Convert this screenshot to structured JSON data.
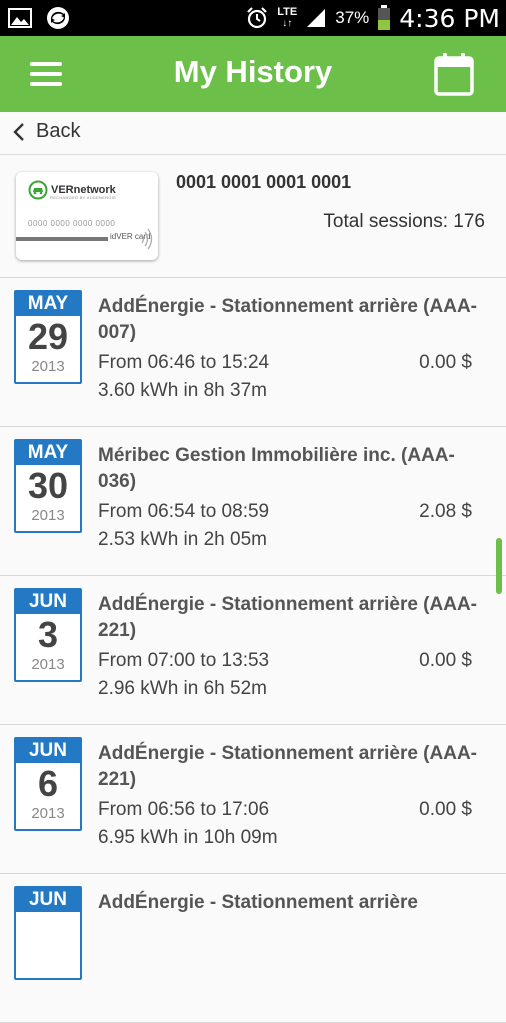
{
  "status_bar": {
    "network": "LTE",
    "battery": "37%",
    "time": "4:36 PM"
  },
  "app_bar": {
    "title": "My History"
  },
  "nav": {
    "back_label": "Back"
  },
  "card": {
    "logo_text": "VERnetwork",
    "logo_sub": "RECHARGED BY ADDENERGIE",
    "printed_number": "0000 0000 0000 0000",
    "brand": "idVER card",
    "number": "0001 0001 0001 0001",
    "total_sessions": "Total sessions: 176"
  },
  "sessions": [
    {
      "month": "MAY",
      "day": "29",
      "year": "2013",
      "station": "AddÉnergie - Stationnement arrière (AAA-007)",
      "times": "From 06:46 to 15:24",
      "price": "0.00 $",
      "energy": "3.60 kWh in 8h 37m"
    },
    {
      "month": "MAY",
      "day": "30",
      "year": "2013",
      "station": "Méribec Gestion Immobilière inc. (AAA-036)",
      "times": "From 06:54 to 08:59",
      "price": "2.08 $",
      "energy": "2.53 kWh in 2h 05m"
    },
    {
      "month": "JUN",
      "day": "3",
      "year": "2013",
      "station": "AddÉnergie - Stationnement arrière (AAA-221)",
      "times": "From 07:00 to 13:53",
      "price": "0.00 $",
      "energy": "2.96 kWh in 6h 52m"
    },
    {
      "month": "JUN",
      "day": "6",
      "year": "2013",
      "station": "AddÉnergie - Stationnement arrière (AAA-221)",
      "times": "From 06:56 to 17:06",
      "price": "0.00 $",
      "energy": "6.95 kWh in 10h 09m"
    },
    {
      "month": "JUN",
      "day": "",
      "year": "",
      "station": "AddÉnergie - Stationnement arrière",
      "times": "",
      "price": "",
      "energy": ""
    }
  ],
  "colors": {
    "accent_green": "#6cc04a",
    "date_blue": "#2379c4"
  }
}
